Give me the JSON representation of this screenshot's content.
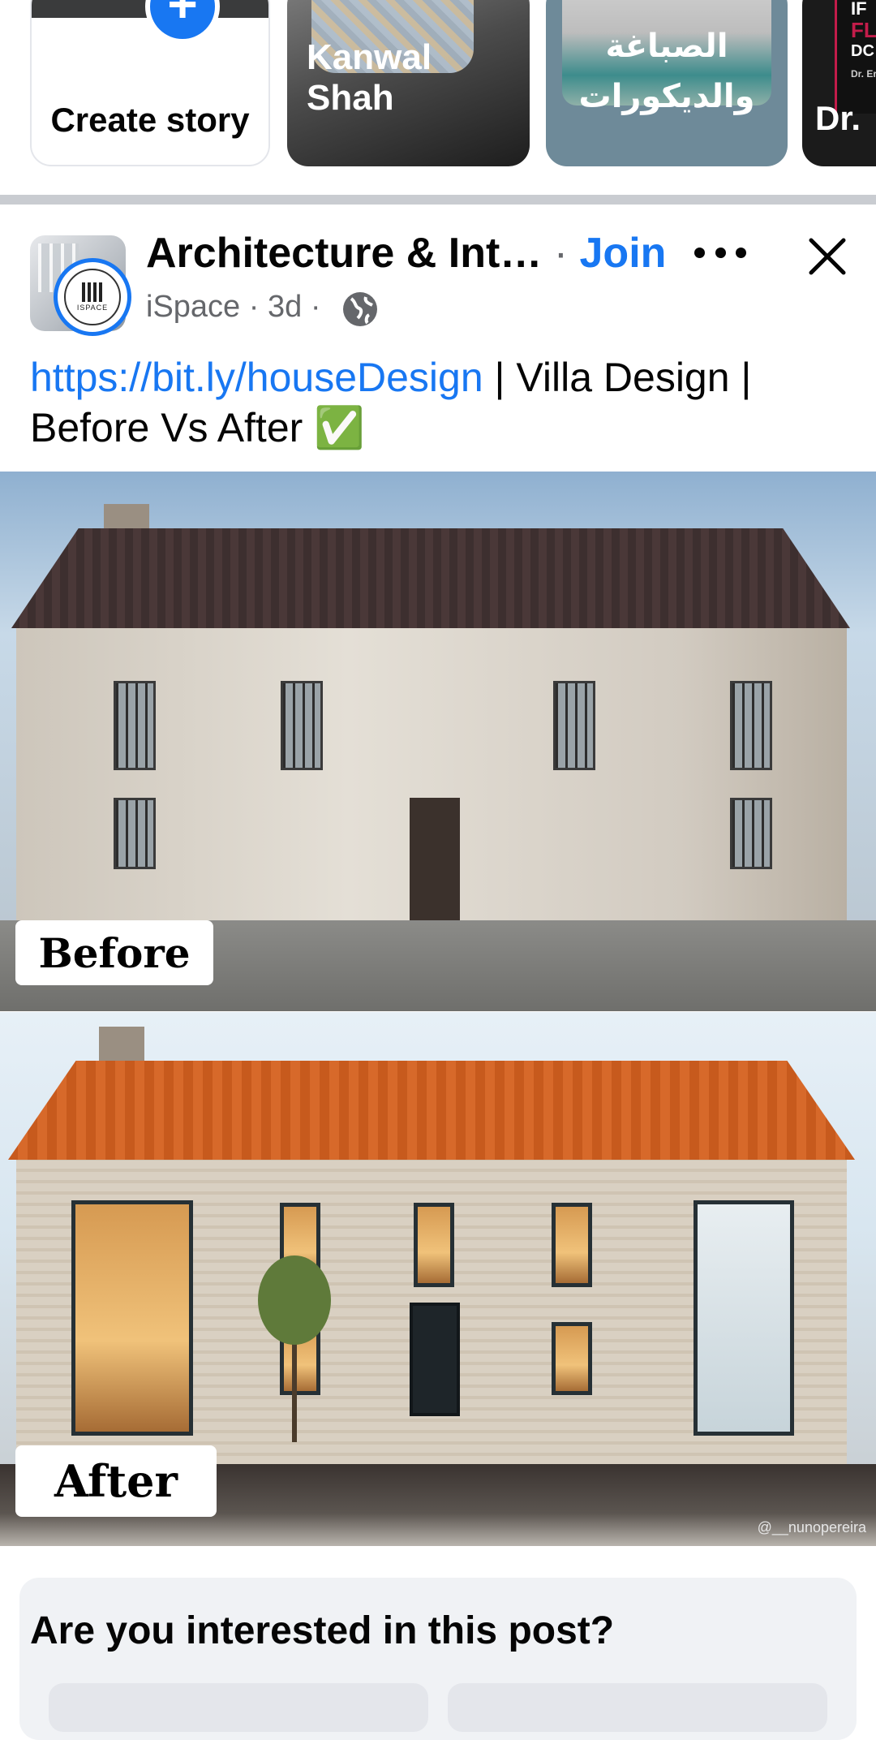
{
  "stories": [
    {
      "type": "create",
      "label": "Create story"
    },
    {
      "type": "user",
      "name": "Kanwal Shah"
    },
    {
      "type": "page",
      "name": "الصباغة والديكورات"
    },
    {
      "type": "page",
      "name": "Dr.",
      "tags": [
        "IF",
        "FL",
        "DC",
        "Dr. Eric"
      ]
    }
  ],
  "post": {
    "group_name": "Architecture & Int…",
    "separator": " · ",
    "join_label": "Join",
    "author": "iSpace",
    "time": "3d",
    "meta_sep": " · ",
    "audience_icon": "globe-icon",
    "page_logo_text": "ISPACE",
    "caption_link": "https://bit.ly/houseDesign",
    "caption_text": " | Villa Design | Before Vs After ✅",
    "images": [
      {
        "label": "Before"
      },
      {
        "label": "After",
        "watermark": "@__nunopereira"
      }
    ]
  },
  "interest_prompt": {
    "title": "Are you interested in this post?"
  },
  "colors": {
    "link": "#1877f2",
    "secondary_text": "#65676b",
    "divider": "#c9ccd1"
  }
}
